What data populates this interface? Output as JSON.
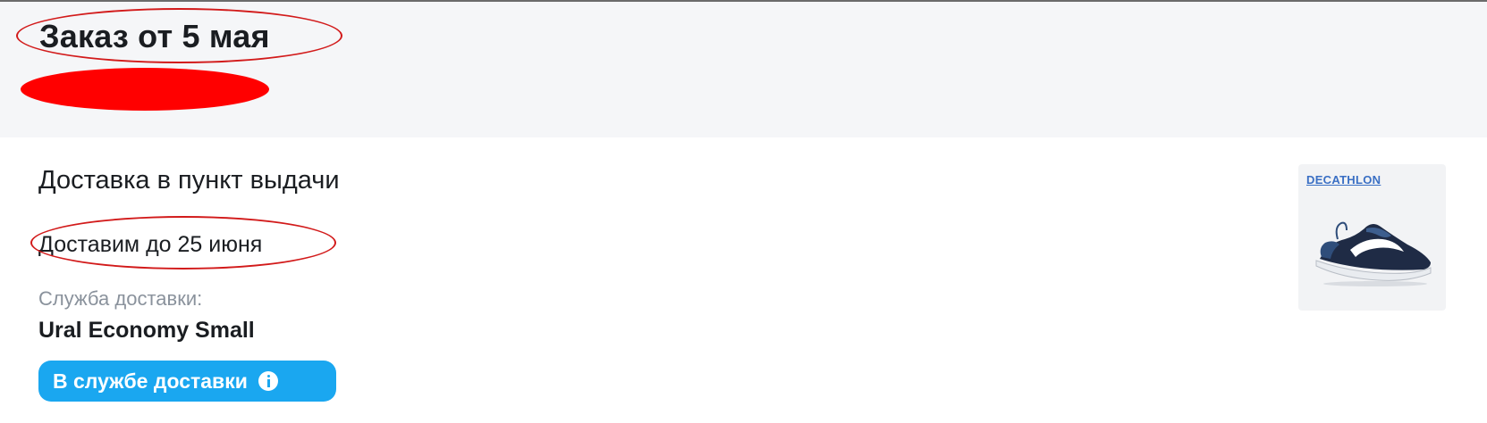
{
  "order": {
    "title": "Заказ от 5 мая"
  },
  "delivery": {
    "type": "Доставка в пункт выдачи",
    "date": "Доставим до 25 июня",
    "service_label": "Служба доставки:",
    "service_value": "Ural Economy Small",
    "status": "В службе доставки"
  },
  "product": {
    "brand": "DECATHLON",
    "image_icon": "running-shoe-icon"
  },
  "colors": {
    "accent": "#1aa7f0",
    "annotation": "#d21a1a",
    "redaction": "#ff0000",
    "header_bg": "#f5f6f8"
  }
}
